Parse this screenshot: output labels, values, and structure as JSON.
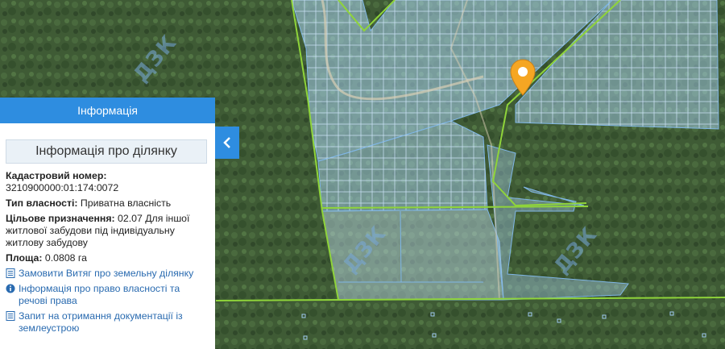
{
  "panel": {
    "header": "Інформація",
    "subheader": "Інформація про ділянку",
    "cadastral_label": "Кадастровий номер:",
    "cadastral_value": "3210900000:01:174:0072",
    "ownership_label": "Тип власності:",
    "ownership_value": "Приватна власність",
    "purpose_label": "Цільове призначення:",
    "purpose_value": "02.07 Для іншої житлової забудови під індивідуальну житлову забудову",
    "area_label": "Площа:",
    "area_value": "0.0808 га",
    "links": [
      {
        "label": "Замовити Витяг про земельну ділянку",
        "icon": "document-icon"
      },
      {
        "label": "Інформація про право власності та речові права",
        "icon": "info-icon"
      },
      {
        "label": "Запит на отримання документації із землеустрою",
        "icon": "document-icon"
      }
    ]
  },
  "map": {
    "watermark": "ДЗК",
    "collapse_icon": "chevron-left-icon",
    "marker_icon": "map-pin-icon",
    "colors": {
      "panel_header": "#2e8de0",
      "parcel_fill": "#a9d3f2",
      "parcel_stroke": "#7fb6e6",
      "boundary": "#8fd43a",
      "marker": "#f5a623",
      "forest": "#3e5a33"
    }
  }
}
